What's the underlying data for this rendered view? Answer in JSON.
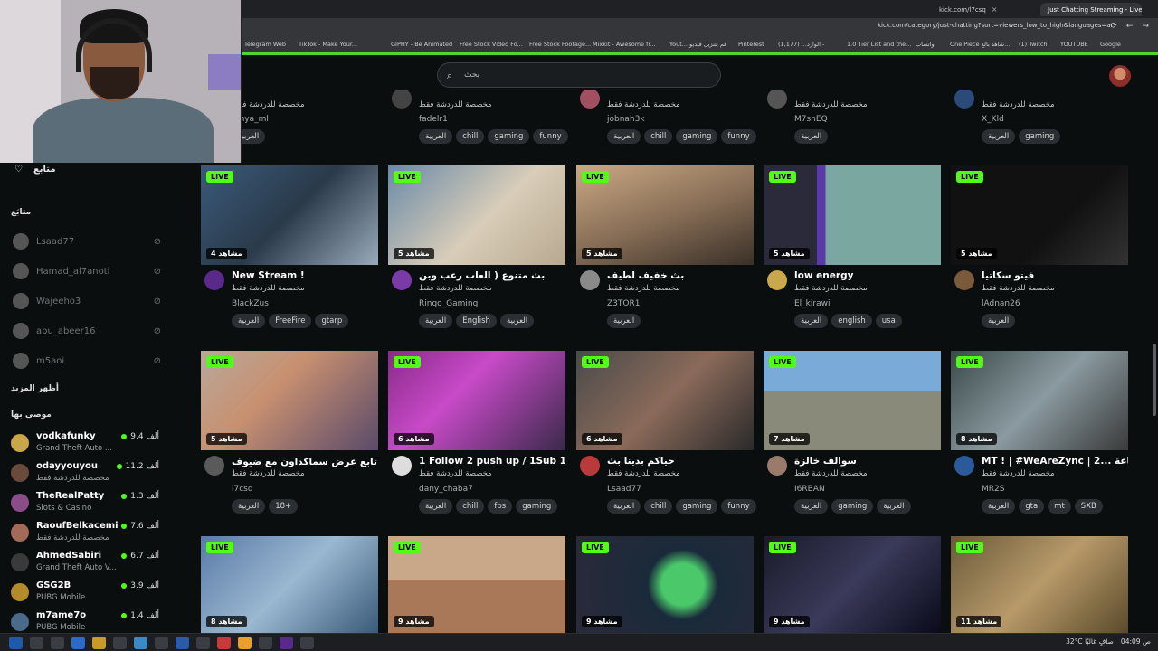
{
  "browser": {
    "tabs": [
      {
        "label": "kick.com/l7csq",
        "active": false
      },
      {
        "label": "Just Chatting Streaming - Live",
        "active": true
      }
    ],
    "url": "kick.com/category/just-chatting?sort=viewers_low_to_high&languages=ar",
    "bookmarks": [
      "Telegram Web",
      "TikTok - Make Your...",
      "GIPHY - Be Animated",
      "Free Stock Video Fo...",
      "Free Stock Footage...",
      "Mixkit - Awesome fr...",
      "Yout... فم بتنزيل فيديو",
      "Pinterest",
      "(1,177) ...الوارد - ",
      "1.0 Tier List and the...",
      "واتساب",
      "One Piece شاهد بالع...",
      "(1) Twitch",
      "YOUTUBE",
      "Google"
    ]
  },
  "search": {
    "placeholder": "بحث"
  },
  "sidebar": {
    "following_label": "متابع",
    "following_section": "متابَع",
    "following": [
      "Lsaad77",
      "Hamad_al7anoti",
      "Wajeeho3",
      "abu_abeer16",
      "m5aoi"
    ],
    "show_more": "أظهر المزيد",
    "recommended_label": "موصى بها",
    "recommended": [
      {
        "name": "vodkafunky",
        "category": "Grand Theft Auto ...",
        "viewers": "9.4 ألف"
      },
      {
        "name": "odayyouyou",
        "category": "مخصصة للدردشة فقط",
        "viewers": "11.2 ألف"
      },
      {
        "name": "TheRealPatty",
        "category": "Slots & Casino",
        "viewers": "1.3 ألف"
      },
      {
        "name": "RaoufBelkacemi",
        "category": "مخصصة للدردشة فقط",
        "viewers": "7.6 ألف"
      },
      {
        "name": "AhmedSabiri",
        "category": "Grand Theft Auto V...",
        "viewers": "6.7 ألف"
      },
      {
        "name": "GSG2B",
        "category": "PUBG Mobile",
        "viewers": "3.9 ألف"
      },
      {
        "name": "m7ame7o",
        "category": "PUBG Mobile",
        "viewers": "1.4 ألف"
      }
    ]
  },
  "live_badge": "LIVE",
  "top_row": [
    {
      "category": "مخصصة للدردشة فقط",
      "user": "...hya_ml",
      "tags": [
        "العربية"
      ]
    },
    {
      "category": "مخصصة للدردشة فقط",
      "user": "fadelr1",
      "tags": [
        "العربية",
        "chill",
        "gaming",
        "funny"
      ]
    },
    {
      "category": "مخصصة للدردشة فقط",
      "user": "jobnah3k",
      "tags": [
        "العربية",
        "chill",
        "gaming",
        "funny"
      ]
    },
    {
      "category": "مخصصة للدردشة فقط",
      "user": "M7snEQ",
      "tags": [
        "العربية"
      ]
    },
    {
      "category": "مخصصة للدردشة فقط",
      "user": "X_Kld",
      "tags": [
        "العربية",
        "gaming"
      ]
    }
  ],
  "row1": [
    {
      "viewers": "4 مشاهد",
      "title": "New Stream !",
      "category": "مخصصة للدردشة فقط",
      "user": "BlackZus",
      "tags": [
        "العربية",
        "FreeFire",
        "gtarp"
      ]
    },
    {
      "viewers": "5 مشاهد",
      "title": "بث متنوع ( العاب رعب وبن",
      "category": "مخصصة للدردشة فقط",
      "user": "Ringo_Gaming",
      "tags": [
        "العربية",
        "English",
        "العربية"
      ]
    },
    {
      "viewers": "5 مشاهد",
      "title": "بث خفيف لطيف",
      "category": "مخصصة للدردشة فقط",
      "user": "Z3TOR1",
      "tags": [
        "العربية"
      ]
    },
    {
      "viewers": "5 مشاهد",
      "title": "low energy",
      "category": "مخصصة للدردشة فقط",
      "user": "El_kirawi",
      "tags": [
        "العربية",
        "english",
        "usa"
      ]
    },
    {
      "viewers": "5 مشاهد",
      "title": "فيتو سكاتيا",
      "category": "مخصصة للدردشة فقط",
      "user": "lAdnan26",
      "tags": [
        "العربية"
      ]
    }
  ],
  "row2": [
    {
      "viewers": "5 مشاهد",
      "title": "تابع عرض سماكداون مع ضيوف 🔥🔥",
      "category": "مخصصة للدردشة فقط",
      "user": "l7csq",
      "tags": [
        "العربية",
        "18+"
      ]
    },
    {
      "viewers": "6 مشاهد",
      "title": "1 Follow 2 push up / 1Sub 10...",
      "category": "مخصصة للدردشة فقط",
      "user": "dany_chaba7",
      "tags": [
        "العربية",
        "chill",
        "fps",
        "gaming"
      ]
    },
    {
      "viewers": "6 مشاهد",
      "title": "حياكم بدينا بث",
      "category": "مخصصة للدردشة فقط",
      "user": "Lsaad77",
      "tags": [
        "العربية",
        "chill",
        "gaming",
        "funny"
      ]
    },
    {
      "viewers": "7 مشاهد",
      "title": "سوالف خالزة",
      "category": "مخصصة للدردشة فقط",
      "user": "I6RBAN",
      "tags": [
        "العربية",
        "gaming",
        "العربية"
      ]
    },
    {
      "viewers": "8 مشاهد",
      "title": "MT ! | #WeAreZync | 2... ساعة",
      "category": "مخصصة للدردشة فقط",
      "user": "MR2S",
      "tags": [
        "العربية",
        "gta",
        "mt",
        "SXB"
      ]
    }
  ],
  "row3": [
    {
      "viewers": "8 مشاهد"
    },
    {
      "viewers": "9 مشاهد"
    },
    {
      "viewers": "9 مشاهد"
    },
    {
      "viewers": "9 مشاهد"
    },
    {
      "viewers": "11 مشاهد"
    }
  ],
  "taskbar": {
    "weather": "32°C صافٍ غالبًا",
    "time": "04:09 ص"
  }
}
